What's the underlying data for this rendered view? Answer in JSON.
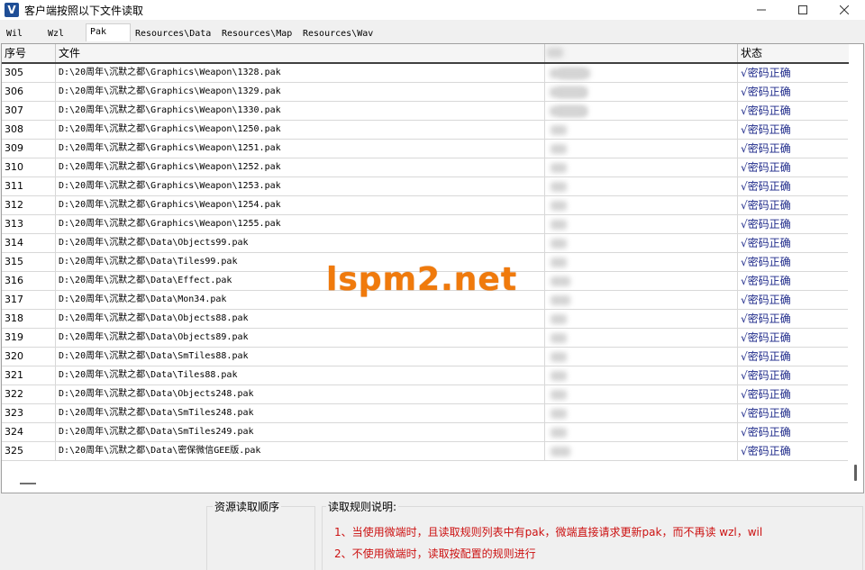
{
  "window": {
    "title": "客户端按照以下文件读取",
    "icon_letter": "V"
  },
  "tabs": [
    {
      "label": "Wil",
      "active": false
    },
    {
      "label": "Wzl",
      "active": false
    },
    {
      "label": "Pak",
      "active": true
    },
    {
      "label": "Resources\\Data",
      "active": false
    },
    {
      "label": "Resources\\Map",
      "active": false
    },
    {
      "label": "Resources\\Wav",
      "active": false
    }
  ],
  "grid": {
    "headers": {
      "index": "序号",
      "file": "文件",
      "status": "状态"
    },
    "rows": [
      {
        "index": "305",
        "file": "D:\\20周年\\沉默之都\\Graphics\\Weapon\\1328.pak",
        "status": "√密码正确"
      },
      {
        "index": "306",
        "file": "D:\\20周年\\沉默之都\\Graphics\\Weapon\\1329.pak",
        "status": "√密码正确"
      },
      {
        "index": "307",
        "file": "D:\\20周年\\沉默之都\\Graphics\\Weapon\\1330.pak",
        "status": "√密码正确"
      },
      {
        "index": "308",
        "file": "D:\\20周年\\沉默之都\\Graphics\\Weapon\\1250.pak",
        "status": "√密码正确"
      },
      {
        "index": "309",
        "file": "D:\\20周年\\沉默之都\\Graphics\\Weapon\\1251.pak",
        "status": "√密码正确"
      },
      {
        "index": "310",
        "file": "D:\\20周年\\沉默之都\\Graphics\\Weapon\\1252.pak",
        "status": "√密码正确"
      },
      {
        "index": "311",
        "file": "D:\\20周年\\沉默之都\\Graphics\\Weapon\\1253.pak",
        "status": "√密码正确"
      },
      {
        "index": "312",
        "file": "D:\\20周年\\沉默之都\\Graphics\\Weapon\\1254.pak",
        "status": "√密码正确"
      },
      {
        "index": "313",
        "file": "D:\\20周年\\沉默之都\\Graphics\\Weapon\\1255.pak",
        "status": "√密码正确"
      },
      {
        "index": "314",
        "file": "D:\\20周年\\沉默之都\\Data\\Objects99.pak",
        "status": "√密码正确"
      },
      {
        "index": "315",
        "file": "D:\\20周年\\沉默之都\\Data\\Tiles99.pak",
        "status": "√密码正确"
      },
      {
        "index": "316",
        "file": "D:\\20周年\\沉默之都\\Data\\Effect.pak",
        "status": "√密码正确"
      },
      {
        "index": "317",
        "file": "D:\\20周年\\沉默之都\\Data\\Mon34.pak",
        "status": "√密码正确"
      },
      {
        "index": "318",
        "file": "D:\\20周年\\沉默之都\\Data\\Objects88.pak",
        "status": "√密码正确"
      },
      {
        "index": "319",
        "file": "D:\\20周年\\沉默之都\\Data\\Objects89.pak",
        "status": "√密码正确"
      },
      {
        "index": "320",
        "file": "D:\\20周年\\沉默之都\\Data\\SmTiles88.pak",
        "status": "√密码正确"
      },
      {
        "index": "321",
        "file": "D:\\20周年\\沉默之都\\Data\\Tiles88.pak",
        "status": "√密码正确"
      },
      {
        "index": "322",
        "file": "D:\\20周年\\沉默之都\\Data\\Objects248.pak",
        "status": "√密码正确"
      },
      {
        "index": "323",
        "file": "D:\\20周年\\沉默之都\\Data\\SmTiles248.pak",
        "status": "√密码正确"
      },
      {
        "index": "324",
        "file": "D:\\20周年\\沉默之都\\Data\\SmTiles249.pak",
        "status": "√密码正确"
      },
      {
        "index": "325",
        "file": "D:\\20周年\\沉默之都\\Data\\密保微信GEE版.pak",
        "status": "√密码正确"
      }
    ]
  },
  "watermark": "lspm2.net",
  "panels": {
    "order_title": "资源读取顺序",
    "rules_title": "读取规则说明:",
    "rules": [
      "1、当使用微端时，且读取规则列表中有pak，微端直接请求更新pak，而不再读 wzl，wil",
      "2、不使用微端时，读取按配置的规则进行"
    ]
  },
  "colors": {
    "status_text": "#1e2a8a",
    "rule_text": "#cc1111",
    "watermark": "#f07a0c",
    "app_icon": "#1f4e96"
  }
}
